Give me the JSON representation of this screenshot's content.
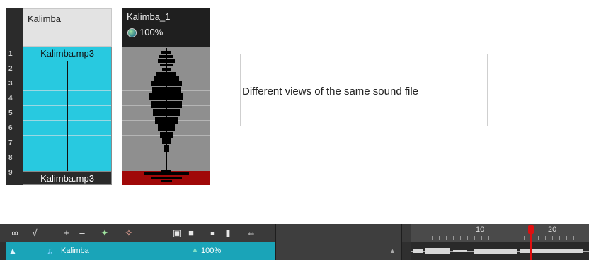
{
  "xsheet": {
    "column_name": "Kalimba",
    "rows": [
      "1",
      "2",
      "3",
      "4",
      "5",
      "6",
      "7",
      "8",
      "9"
    ],
    "first_cell": "Kalimba.mp3",
    "last_cell": "Kalimba.mp3"
  },
  "waveform_column": {
    "name": "Kalimba_1",
    "volume": "100%"
  },
  "caption": "Different views of the same sound file",
  "timeline": {
    "layer_name": "Kalimba",
    "layer_volume": "100%",
    "ruler_labels": [
      "10",
      "20"
    ],
    "toolbar_icons": [
      "onion-skin-icon",
      "onion-skin-settings-icon",
      "add-icon",
      "remove-icon",
      "add-drawing-icon",
      "add-peg-icon",
      "frame-icon",
      "square-large-icon",
      "square-small-icon",
      "square-white-icon",
      "split-icon"
    ]
  }
}
